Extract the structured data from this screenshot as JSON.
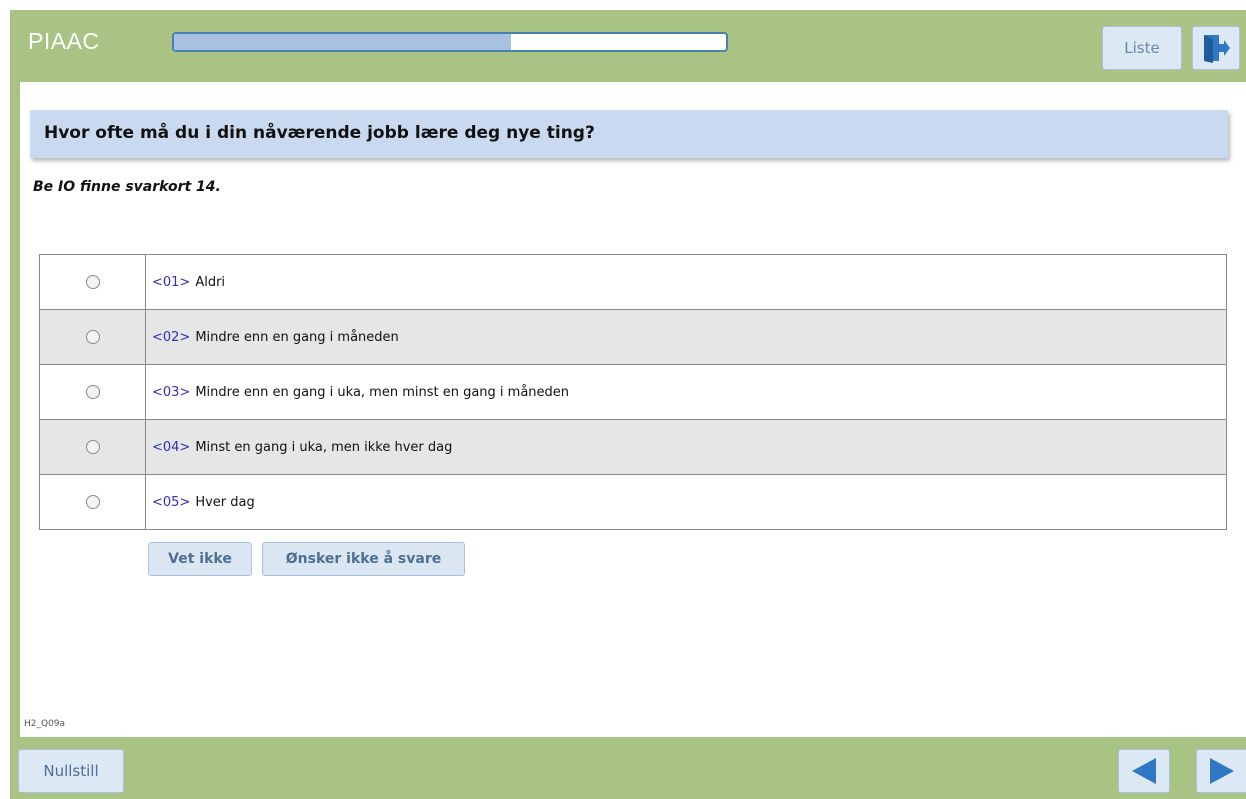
{
  "header": {
    "app_title": "PIAAC",
    "progress_fraction": 0.61,
    "list_label": "Liste",
    "exit_icon": "exit-door-icon"
  },
  "question": {
    "text": "Hvor ofte må du i din nåværende jobb lære deg nye ting?",
    "instruction": "Be IO finne svarkort 14."
  },
  "options": [
    {
      "code": "<01>",
      "label": "Aldri"
    },
    {
      "code": "<02>",
      "label": "Mindre enn en gang i måneden"
    },
    {
      "code": "<03>",
      "label": "Mindre enn en gang i uka, men minst en gang i måneden"
    },
    {
      "code": "<04>",
      "label": "Minst en gang i uka, men ikke hver dag"
    },
    {
      "code": "<05>",
      "label": "Hver dag"
    }
  ],
  "buttons": {
    "dont_know": "Vet ikke",
    "refuse": "Ønsker ikke å svare",
    "reset": "Nullstill"
  },
  "screen_id": "H2_Q09a",
  "nav": {
    "prev_icon": "left-arrow-icon",
    "next_icon": "right-arrow-icon"
  },
  "colors": {
    "frame": "#a9c385",
    "question_band": "#c9daf0",
    "button_bg": "#dde8f5",
    "arrow": "#2f79c4",
    "option_alt_row": "#e6e6e6"
  }
}
